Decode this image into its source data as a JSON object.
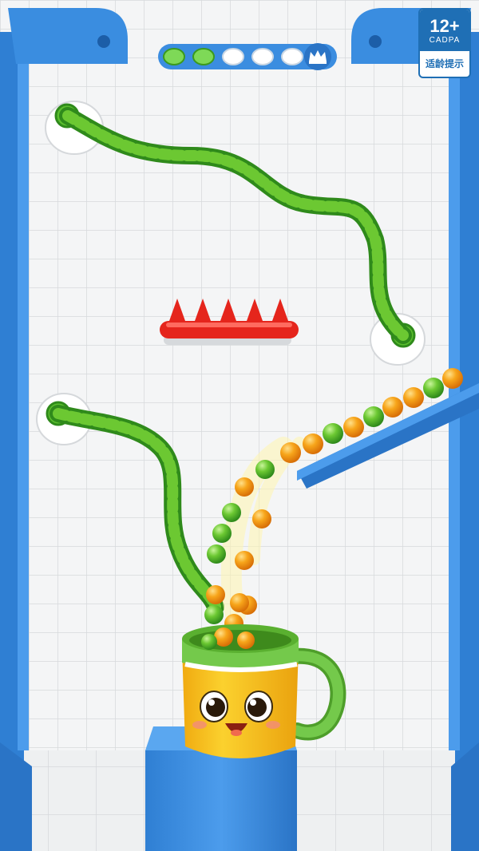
{
  "app": {
    "name": "rope-ball-cup-puzzle"
  },
  "level_progress": {
    "completed": 2,
    "total": 5,
    "final_icon": "crown-icon",
    "colors": {
      "done": "#7ed957",
      "pending": "#ffffff",
      "track": "#3b8de0"
    }
  },
  "age_rating": {
    "rating": "12+",
    "org": "CADPA",
    "notice": "适龄提示"
  },
  "scene": {
    "colors": {
      "frame_blue": "#3a8de0",
      "wall": "#f2f3f4",
      "grid_line": "#d4d7da",
      "rope_green": "#5bbf2e",
      "rope_stripe": "#2f8a1b",
      "spike_red": "#e5251c",
      "ball_green": "#6cc832",
      "ball_orange": "#f7a51a",
      "cup_yellow": "#f7c21b",
      "cup_green": "#74c94b"
    },
    "pins": [
      "top-left-pin",
      "right-pin",
      "left-lower-pin"
    ],
    "ropes": [
      "upper-rope",
      "lower-rope"
    ],
    "hazard": "spike-bar",
    "ramp_balls": [
      "orange",
      "green",
      "orange",
      "orange",
      "green",
      "orange",
      "green",
      "orange",
      "orange"
    ],
    "falling_balls": [
      "green",
      "orange",
      "green",
      "orange",
      "green",
      "orange",
      "green",
      "orange",
      "orange",
      "green",
      "orange",
      "orange"
    ],
    "cup_expression": "happy"
  }
}
